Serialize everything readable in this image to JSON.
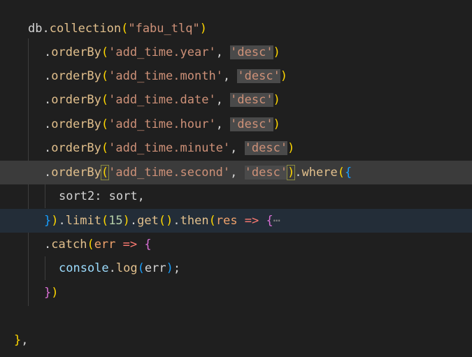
{
  "editor": {
    "lines": [
      {
        "id": "l1",
        "parts": [
          [
            "db",
            "t-id"
          ],
          [
            ".",
            "t-op"
          ],
          [
            "collection",
            "t-fn2"
          ],
          [
            "(",
            "t-p1"
          ],
          [
            "\"fabu_tlq\"",
            "t-str"
          ],
          [
            ")",
            "t-p1"
          ]
        ]
      },
      {
        "id": "l2",
        "parts": [
          [
            ".",
            "t-op"
          ],
          [
            "orderBy",
            "t-fn2"
          ],
          [
            "(",
            "t-p1"
          ],
          [
            "'add_time.year'",
            "t-str"
          ],
          [
            ", ",
            "t-op"
          ],
          [
            "'desc'",
            "t-str"
          ],
          [
            ")",
            "t-p1"
          ]
        ]
      },
      {
        "id": "l3",
        "parts": [
          [
            ".",
            "t-op"
          ],
          [
            "orderBy",
            "t-fn2"
          ],
          [
            "(",
            "t-p1"
          ],
          [
            "'add_time.month'",
            "t-str"
          ],
          [
            ", ",
            "t-op"
          ],
          [
            "'desc'",
            "t-str"
          ],
          [
            ")",
            "t-p1"
          ]
        ]
      },
      {
        "id": "l4",
        "parts": [
          [
            ".",
            "t-op"
          ],
          [
            "orderBy",
            "t-fn2"
          ],
          [
            "(",
            "t-p1"
          ],
          [
            "'add_time.date'",
            "t-str"
          ],
          [
            ", ",
            "t-op"
          ],
          [
            "'desc'",
            "t-str"
          ],
          [
            ")",
            "t-p1"
          ]
        ]
      },
      {
        "id": "l5",
        "parts": [
          [
            ".",
            "t-op"
          ],
          [
            "orderBy",
            "t-fn2"
          ],
          [
            "(",
            "t-p1"
          ],
          [
            "'add_time.hour'",
            "t-str"
          ],
          [
            ", ",
            "t-op"
          ],
          [
            "'desc'",
            "t-str"
          ],
          [
            ")",
            "t-p1"
          ]
        ]
      },
      {
        "id": "l6",
        "parts": [
          [
            ".",
            "t-op"
          ],
          [
            "orderBy",
            "t-fn2"
          ],
          [
            "(",
            "t-p1"
          ],
          [
            "'add_time.minute'",
            "t-str"
          ],
          [
            ", ",
            "t-op"
          ],
          [
            "'desc'",
            "t-str"
          ],
          [
            ")",
            "t-p1"
          ]
        ]
      },
      {
        "id": "l7",
        "parts": [
          [
            ".",
            "t-op"
          ],
          [
            "orderBy",
            "t-fn2"
          ],
          [
            "(",
            "t-p1"
          ],
          [
            "'add_time.second'",
            "t-str"
          ],
          [
            ", ",
            "t-op"
          ],
          [
            "'desc'",
            "t-str"
          ],
          [
            ")",
            "t-p1"
          ],
          [
            ".",
            "t-op"
          ],
          [
            "where",
            "t-fn2"
          ],
          [
            "(",
            "t-p1"
          ],
          [
            "{",
            "t-p3"
          ]
        ]
      },
      {
        "id": "l8",
        "parts": [
          [
            "sort2",
            "t-id"
          ],
          [
            ": ",
            "t-op"
          ],
          [
            "sort",
            "t-id"
          ],
          [
            ",",
            "t-op"
          ]
        ]
      },
      {
        "id": "l9",
        "parts": [
          [
            "}",
            "t-p3"
          ],
          [
            ")",
            "t-p1"
          ],
          [
            ".",
            "t-op"
          ],
          [
            "limit",
            "t-fn2"
          ],
          [
            "(",
            "t-p1"
          ],
          [
            "15",
            "t-num"
          ],
          [
            ")",
            "t-p1"
          ],
          [
            ".",
            "t-op"
          ],
          [
            "get",
            "t-fn2"
          ],
          [
            "(",
            "t-p1"
          ],
          [
            ")",
            "t-p1"
          ],
          [
            ".",
            "t-op"
          ],
          [
            "then",
            "t-fn2"
          ],
          [
            "(",
            "t-p1"
          ],
          [
            "res",
            "t-orange"
          ],
          [
            " => ",
            "t-kw"
          ],
          [
            "{",
            "t-p2"
          ],
          [
            "⋯",
            "fold"
          ]
        ]
      },
      {
        "id": "l10",
        "parts": [
          [
            ".",
            "t-op"
          ],
          [
            "catch",
            "t-fn2"
          ],
          [
            "(",
            "t-p1"
          ],
          [
            "err",
            "t-orange"
          ],
          [
            " => ",
            "t-kw"
          ],
          [
            "{",
            "t-p2"
          ]
        ]
      },
      {
        "id": "l11",
        "parts": [
          [
            "console",
            "t-prop"
          ],
          [
            ".",
            "t-op"
          ],
          [
            "log",
            "t-fn2"
          ],
          [
            "(",
            "t-p3"
          ],
          [
            "err",
            "t-id"
          ],
          [
            ")",
            "t-p3"
          ],
          [
            ";",
            "t-op"
          ]
        ]
      },
      {
        "id": "l12",
        "parts": [
          [
            "}",
            "t-p2"
          ],
          [
            ")",
            "t-p1"
          ]
        ]
      },
      {
        "id": "l13",
        "parts": []
      },
      {
        "id": "l14",
        "parts": [
          [
            "}",
            "t-p1"
          ],
          [
            ",",
            "t-op"
          ]
        ]
      }
    ]
  },
  "colors": {
    "background": "#1f1f1f",
    "current_line": "#3b3b3b",
    "selected_line": "#232d38",
    "string": "#ce9178",
    "function": "#e2c08d",
    "bracket_gold": "#ffd700",
    "bracket_purple": "#da70d6",
    "bracket_blue": "#179fff"
  },
  "icons": {
    "fold": "ellipsis-icon"
  }
}
